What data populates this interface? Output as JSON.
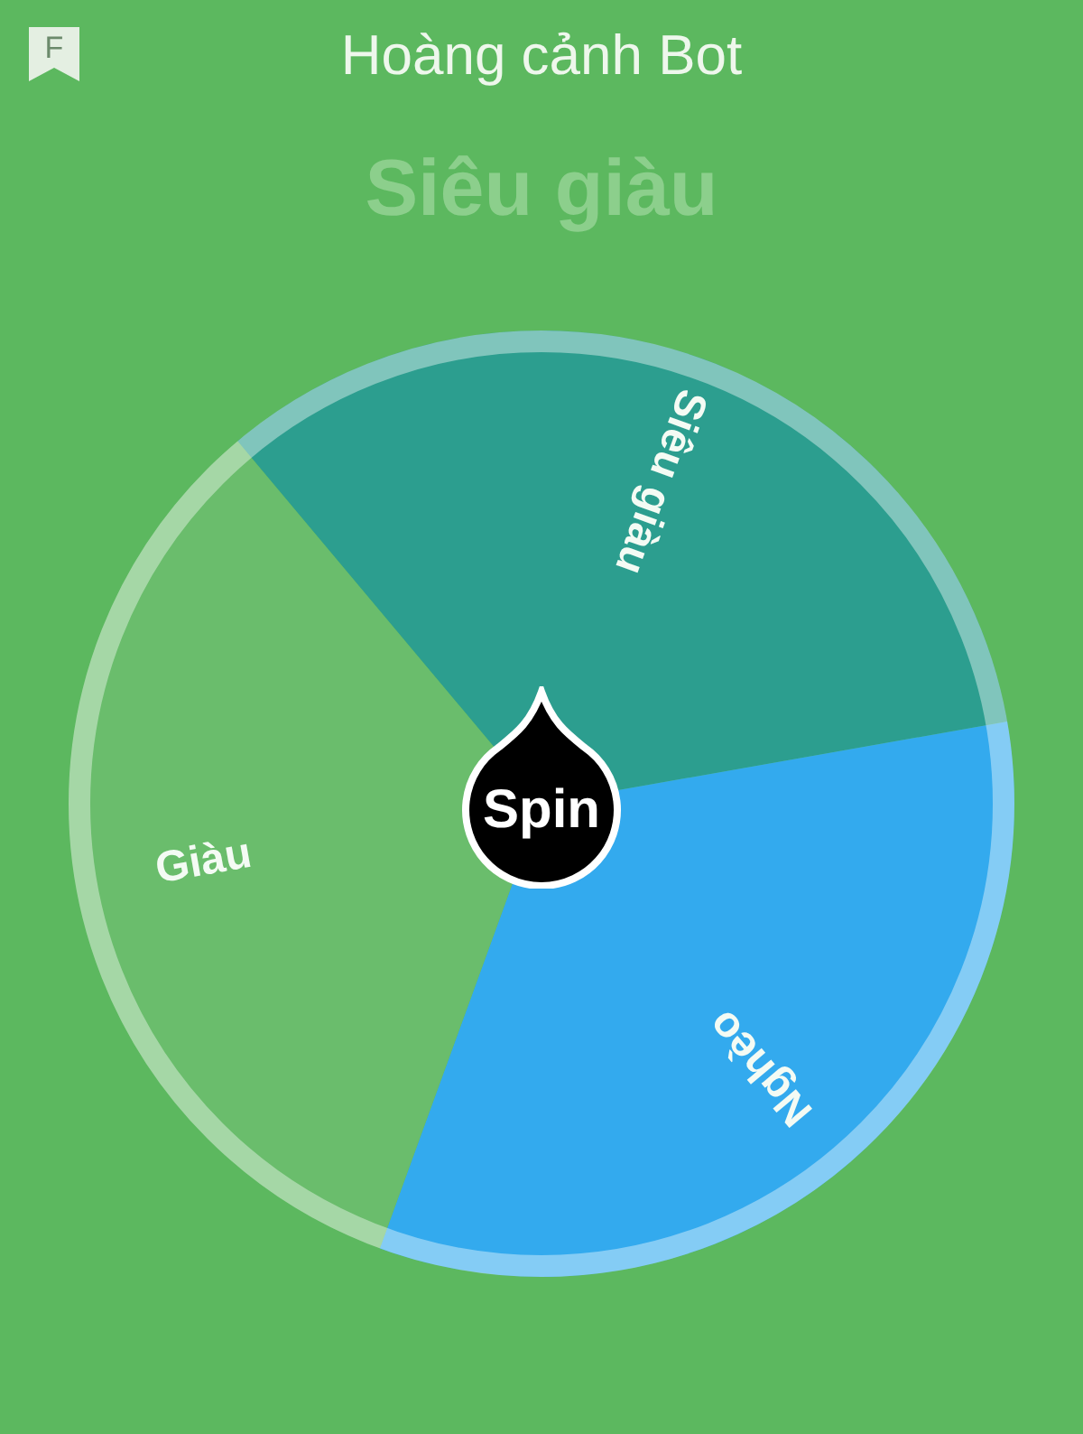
{
  "header": {
    "badge": "F",
    "title": "Hoàng cảnh Bot"
  },
  "result": "Siêu giàu",
  "wheel": {
    "segments": [
      {
        "label": "Siêu giàu",
        "color": "#2c9e8f"
      },
      {
        "label": "Nghèo",
        "color": "#33aaee"
      },
      {
        "label": "Giàu",
        "color": "#6abd6c"
      }
    ]
  },
  "spin_button": "Spin"
}
